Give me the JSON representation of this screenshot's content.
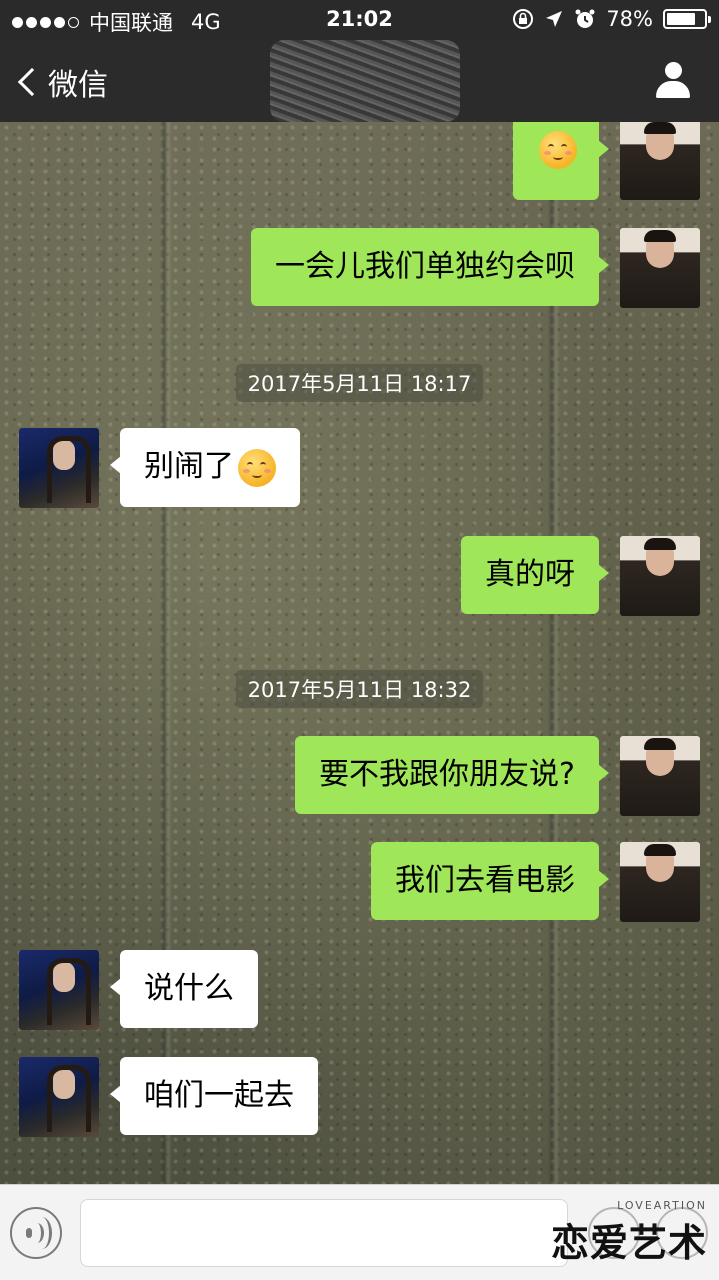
{
  "status_bar": {
    "carrier": "中国联通",
    "network": "4G",
    "time": "21:02",
    "battery_percent": "78%",
    "battery_level": 0.78
  },
  "nav": {
    "back_label": "微信"
  },
  "messages": [
    {
      "side": "out",
      "type": "emoji",
      "emoji": "blushing-smile-emoji"
    },
    {
      "side": "out",
      "text": "一会儿我们单独约会呗"
    },
    {
      "type": "timestamp",
      "text": "2017年5月11日 18:17"
    },
    {
      "side": "in",
      "text": "别闹了",
      "emoji": "blushing-smile-emoji"
    },
    {
      "side": "out",
      "text": "真的呀"
    },
    {
      "type": "timestamp",
      "text": "2017年5月11日 18:32"
    },
    {
      "side": "out",
      "text": "要不我跟你朋友说?"
    },
    {
      "side": "out",
      "text": "我们去看电影"
    },
    {
      "side": "in",
      "text": "说什么"
    },
    {
      "side": "in",
      "text": "咱们一起去"
    }
  ],
  "input_bar": {
    "value": "",
    "watermark_small": "LOVEARTION",
    "watermark_big": "恋爱艺术"
  },
  "colors": {
    "outgoing_bubble": "#9fe658",
    "incoming_bubble": "#ffffff",
    "nav_background": "#2b2b2b"
  }
}
